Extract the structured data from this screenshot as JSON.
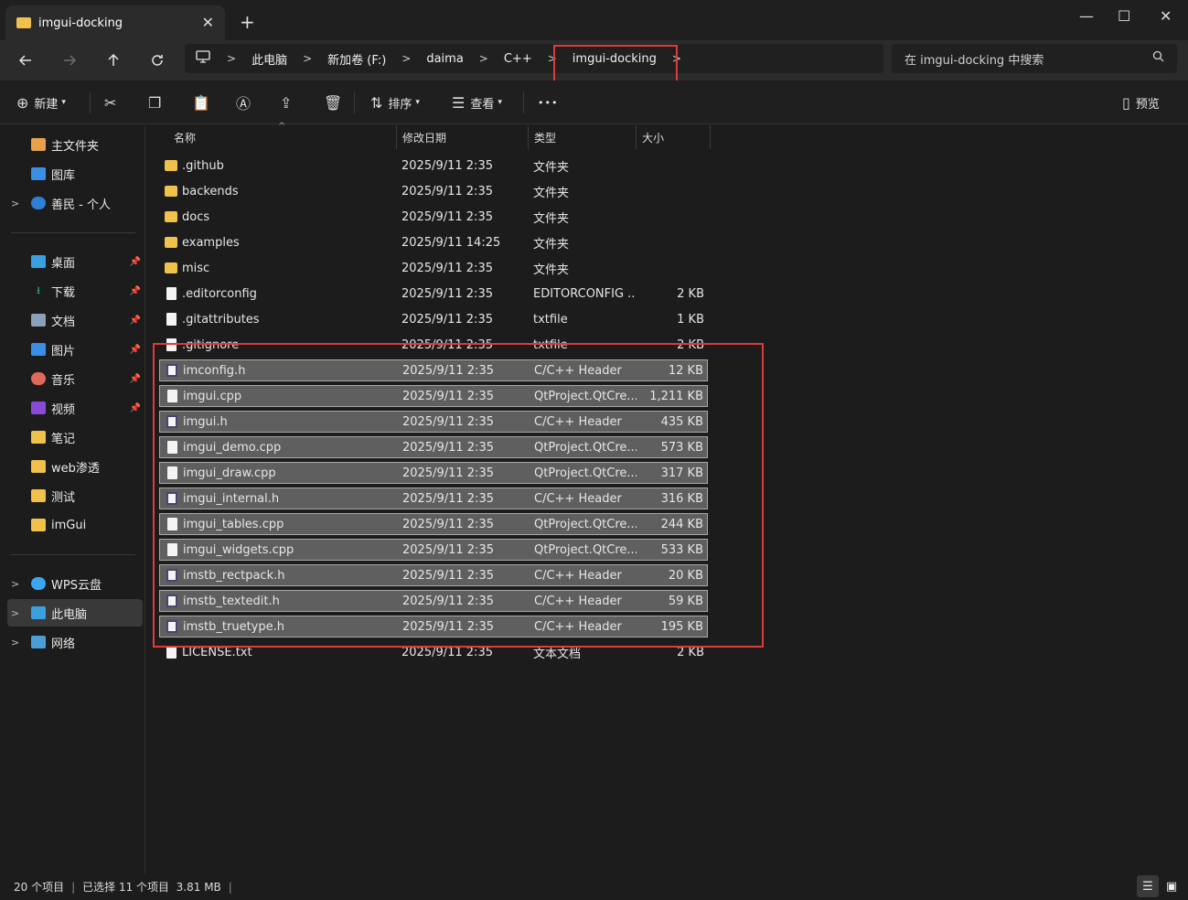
{
  "tab": {
    "title": "imgui-docking",
    "close": "✕",
    "new": "+"
  },
  "window": {
    "minimize": "—",
    "maximize": "☐",
    "close": "✕"
  },
  "breadcrumb": [
    "此电脑",
    "新加卷 (F:)",
    "daima",
    "C++",
    "imgui-docking"
  ],
  "search": {
    "placeholder": "在 imgui-docking 中搜索"
  },
  "toolbar": {
    "new_label": "新建",
    "sort_label": "排序",
    "view_label": "查看",
    "preview_label": "预览",
    "more": "•••"
  },
  "sidebar": {
    "items": [
      {
        "label": "主文件夹",
        "icon": "home-icon"
      },
      {
        "label": "图库",
        "icon": "gallery-icon"
      },
      {
        "label": "善民 - 个人",
        "icon": "onedrive-icon"
      },
      {
        "label": "桌面",
        "icon": "desktop-icon"
      },
      {
        "label": "下载",
        "icon": "download-icon"
      },
      {
        "label": "文档",
        "icon": "documents-icon"
      },
      {
        "label": "图片",
        "icon": "pictures-icon"
      },
      {
        "label": "音乐",
        "icon": "music-icon"
      },
      {
        "label": "视频",
        "icon": "videos-icon"
      },
      {
        "label": "笔记",
        "icon": "folder-icon"
      },
      {
        "label": "web渗透",
        "icon": "folder-icon"
      },
      {
        "label": "测试",
        "icon": "folder-icon"
      },
      {
        "label": "imGui",
        "icon": "folder-icon"
      },
      {
        "label": "WPS云盘",
        "icon": "wps-cloud-icon"
      },
      {
        "label": "此电脑",
        "icon": "this-pc-icon"
      },
      {
        "label": "网络",
        "icon": "network-icon"
      }
    ]
  },
  "columns": {
    "name": "名称",
    "date": "修改日期",
    "type": "类型",
    "size": "大小"
  },
  "files": [
    {
      "name": ".github",
      "date": "2025/9/11 2:35",
      "type": "文件夹",
      "size": "",
      "kind": "folder",
      "selected": false
    },
    {
      "name": "backends",
      "date": "2025/9/11 2:35",
      "type": "文件夹",
      "size": "",
      "kind": "folder",
      "selected": false
    },
    {
      "name": "docs",
      "date": "2025/9/11 2:35",
      "type": "文件夹",
      "size": "",
      "kind": "folder",
      "selected": false
    },
    {
      "name": "examples",
      "date": "2025/9/11 14:25",
      "type": "文件夹",
      "size": "",
      "kind": "folder",
      "selected": false
    },
    {
      "name": "misc",
      "date": "2025/9/11 2:35",
      "type": "文件夹",
      "size": "",
      "kind": "folder",
      "selected": false
    },
    {
      "name": ".editorconfig",
      "date": "2025/9/11 2:35",
      "type": "EDITORCONFIG ...",
      "size": "2 KB",
      "kind": "file",
      "selected": false
    },
    {
      "name": ".gitattributes",
      "date": "2025/9/11 2:35",
      "type": "txtfile",
      "size": "1 KB",
      "kind": "file",
      "selected": false
    },
    {
      "name": ".gitignore",
      "date": "2025/9/11 2:35",
      "type": "txtfile",
      "size": "2 KB",
      "kind": "file",
      "selected": false
    },
    {
      "name": "imconfig.h",
      "date": "2025/9/11 2:35",
      "type": "C/C++ Header",
      "size": "12 KB",
      "kind": "header",
      "selected": true
    },
    {
      "name": "imgui.cpp",
      "date": "2025/9/11 2:35",
      "type": "QtProject.QtCre...",
      "size": "1,211 KB",
      "kind": "file",
      "selected": true
    },
    {
      "name": "imgui.h",
      "date": "2025/9/11 2:35",
      "type": "C/C++ Header",
      "size": "435 KB",
      "kind": "header",
      "selected": true
    },
    {
      "name": "imgui_demo.cpp",
      "date": "2025/9/11 2:35",
      "type": "QtProject.QtCre...",
      "size": "573 KB",
      "kind": "file",
      "selected": true
    },
    {
      "name": "imgui_draw.cpp",
      "date": "2025/9/11 2:35",
      "type": "QtProject.QtCre...",
      "size": "317 KB",
      "kind": "file",
      "selected": true
    },
    {
      "name": "imgui_internal.h",
      "date": "2025/9/11 2:35",
      "type": "C/C++ Header",
      "size": "316 KB",
      "kind": "header",
      "selected": true
    },
    {
      "name": "imgui_tables.cpp",
      "date": "2025/9/11 2:35",
      "type": "QtProject.QtCre...",
      "size": "244 KB",
      "kind": "file",
      "selected": true
    },
    {
      "name": "imgui_widgets.cpp",
      "date": "2025/9/11 2:35",
      "type": "QtProject.QtCre...",
      "size": "533 KB",
      "kind": "file",
      "selected": true
    },
    {
      "name": "imstb_rectpack.h",
      "date": "2025/9/11 2:35",
      "type": "C/C++ Header",
      "size": "20 KB",
      "kind": "header",
      "selected": true
    },
    {
      "name": "imstb_textedit.h",
      "date": "2025/9/11 2:35",
      "type": "C/C++ Header",
      "size": "59 KB",
      "kind": "header",
      "selected": true
    },
    {
      "name": "imstb_truetype.h",
      "date": "2025/9/11 2:35",
      "type": "C/C++ Header",
      "size": "195 KB",
      "kind": "header",
      "selected": true
    },
    {
      "name": "LICENSE.txt",
      "date": "2025/9/11 2:35",
      "type": "文本文档",
      "size": "2 KB",
      "kind": "file",
      "selected": false
    }
  ],
  "status": {
    "count": "20 个项目",
    "selection": "已选择 11 个项目  3.81 MB"
  },
  "colors": {
    "highlight": "#e03a3a",
    "selection_bg": "#5f5f5f",
    "folder": "#f1c24b"
  }
}
